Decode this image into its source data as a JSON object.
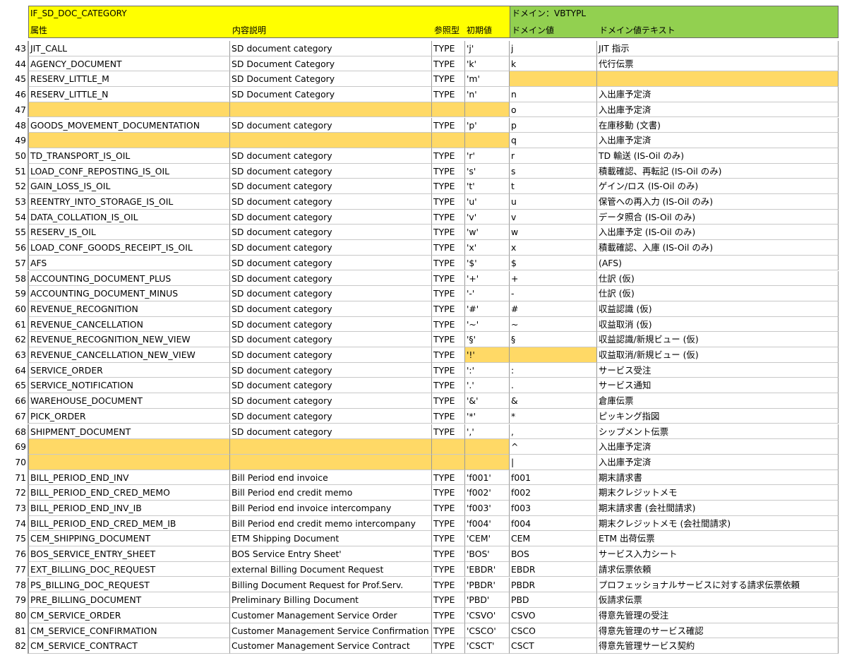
{
  "header": {
    "table_name": "IF_SD_DOC_CATEGORY",
    "col_attribute": "属性",
    "col_description": "内容説明",
    "col_ref_type": "参照型",
    "col_initial_value": "初期値",
    "domain_title": "ドメイン：VBTYPL",
    "col_domain_value": "ドメイン値",
    "col_domain_text": "ドメイン値テキスト"
  },
  "rows": [
    {
      "n": "43",
      "attr": "JIT_CALL",
      "desc": "SD document category",
      "type": "TYPE",
      "init": "'j'",
      "dval": "j",
      "dtext": "JIT 指示",
      "hl": []
    },
    {
      "n": "44",
      "attr": "AGENCY_DOCUMENT",
      "desc": "SD Document Category",
      "type": "TYPE",
      "init": "'k'",
      "dval": "k",
      "dtext": "代行伝票",
      "hl": []
    },
    {
      "n": "45",
      "attr": "RESERV_LITTLE_M",
      "desc": "SD Document Category",
      "type": "TYPE",
      "init": "'m'",
      "dval": "",
      "dtext": "",
      "hl": [
        "dval",
        "dtext"
      ]
    },
    {
      "n": "46",
      "attr": "RESERV_LITTLE_N",
      "desc": "SD Document Category",
      "type": "TYPE",
      "init": "'n'",
      "dval": "n",
      "dtext": "入出庫予定済",
      "hl": []
    },
    {
      "n": "47",
      "attr": "",
      "desc": "",
      "type": "",
      "init": "",
      "dval": "o",
      "dtext": "入出庫予定済",
      "hl": [
        "attr",
        "desc",
        "type",
        "init"
      ]
    },
    {
      "n": "48",
      "attr": "GOODS_MOVEMENT_DOCUMENTATION",
      "desc": "SD document category",
      "type": "TYPE",
      "init": "'p'",
      "dval": "p",
      "dtext": "在庫移動 (文書)",
      "hl": []
    },
    {
      "n": "49",
      "attr": "",
      "desc": "",
      "type": "",
      "init": "",
      "dval": "q",
      "dtext": "入出庫予定済",
      "hl": [
        "attr",
        "desc",
        "type",
        "init"
      ]
    },
    {
      "n": "50",
      "attr": "TD_TRANSPORT_IS_OIL",
      "desc": "SD document category",
      "type": "TYPE",
      "init": "'r'",
      "dval": "r",
      "dtext": "TD 輸送 (IS-Oil のみ)",
      "hl": []
    },
    {
      "n": "51",
      "attr": "LOAD_CONF_REPOSTING_IS_OIL",
      "desc": "SD document category",
      "type": "TYPE",
      "init": "'s'",
      "dval": "s",
      "dtext": "積載確認、再転記 (IS-Oil のみ)",
      "hl": []
    },
    {
      "n": "52",
      "attr": "GAIN_LOSS_IS_OIL",
      "desc": "SD document category",
      "type": "TYPE",
      "init": "'t'",
      "dval": "t",
      "dtext": "ゲイン/ロス (IS-Oil のみ)",
      "hl": []
    },
    {
      "n": "53",
      "attr": "REENTRY_INTO_STORAGE_IS_OIL",
      "desc": "SD document category",
      "type": "TYPE",
      "init": "'u'",
      "dval": "u",
      "dtext": "保管への再入力 (IS-Oil のみ)",
      "hl": []
    },
    {
      "n": "54",
      "attr": "DATA_COLLATION_IS_OIL",
      "desc": "SD document category",
      "type": "TYPE",
      "init": "'v'",
      "dval": "v",
      "dtext": "データ照合 (IS-Oil のみ)",
      "hl": []
    },
    {
      "n": "55",
      "attr": "RESERV_IS_OIL",
      "desc": "SD document category",
      "type": "TYPE",
      "init": "'w'",
      "dval": "w",
      "dtext": "入出庫予定 (IS-Oil のみ)",
      "hl": []
    },
    {
      "n": "56",
      "attr": "LOAD_CONF_GOODS_RECEIPT_IS_OIL",
      "desc": "SD document category",
      "type": "TYPE",
      "init": "'x'",
      "dval": "x",
      "dtext": "積載確認、入庫 (IS-Oil のみ)",
      "hl": []
    },
    {
      "n": "57",
      "attr": "AFS",
      "desc": "SD document category",
      "type": "TYPE",
      "init": "'$'",
      "dval": "$",
      "dtext": "(AFS)",
      "hl": []
    },
    {
      "n": "58",
      "attr": "ACCOUNTING_DOCUMENT_PLUS",
      "desc": "SD document category",
      "type": "TYPE",
      "init": "'+'",
      "dval": "+",
      "dtext": "仕訳 (仮)",
      "hl": []
    },
    {
      "n": "59",
      "attr": "ACCOUNTING_DOCUMENT_MINUS",
      "desc": "SD document category",
      "type": "TYPE",
      "init": "'-'",
      "dval": "-",
      "dtext": "仕訳 (仮)",
      "hl": []
    },
    {
      "n": "60",
      "attr": "REVENUE_RECOGNITION",
      "desc": "SD document category",
      "type": "TYPE",
      "init": "'#'",
      "dval": "#",
      "dtext": "収益認識 (仮)",
      "hl": []
    },
    {
      "n": "61",
      "attr": "REVENUE_CANCELLATION",
      "desc": "SD document category",
      "type": "TYPE",
      "init": "'~'",
      "dval": "~",
      "dtext": "収益取消 (仮)",
      "hl": []
    },
    {
      "n": "62",
      "attr": "REVENUE_RECOGNITION_NEW_VIEW",
      "desc": "SD document category",
      "type": "TYPE",
      "init": "'§'",
      "dval": "§",
      "dtext": "収益認識/新規ビュー (仮)",
      "hl": []
    },
    {
      "n": "63",
      "attr": "REVENUE_CANCELLATION_NEW_VIEW",
      "desc": "SD document category",
      "type": "TYPE",
      "init": "'!'",
      "dval": "",
      "dtext": "収益取消/新規ビュー (仮)",
      "hl": [
        "init",
        "dval"
      ]
    },
    {
      "n": "64",
      "attr": "SERVICE_ORDER",
      "desc": "SD document category",
      "type": "TYPE",
      "init": "':'",
      "dval": ":",
      "dtext": "サービス受注",
      "hl": []
    },
    {
      "n": "65",
      "attr": "SERVICE_NOTIFICATION",
      "desc": "SD document category",
      "type": "TYPE",
      "init": "'.'",
      "dval": ".",
      "dtext": "サービス通知",
      "hl": []
    },
    {
      "n": "66",
      "attr": "WAREHOUSE_DOCUMENT",
      "desc": "SD document category",
      "type": "TYPE",
      "init": "'&'",
      "dval": "&",
      "dtext": "倉庫伝票",
      "hl": []
    },
    {
      "n": "67",
      "attr": "PICK_ORDER",
      "desc": "SD document category",
      "type": "TYPE",
      "init": "'*'",
      "dval": "*",
      "dtext": "ピッキング指図",
      "hl": []
    },
    {
      "n": "68",
      "attr": "SHIPMENT_DOCUMENT",
      "desc": "SD document category",
      "type": "TYPE",
      "init": "','",
      "dval": ",",
      "dtext": "シップメント伝票",
      "hl": []
    },
    {
      "n": "69",
      "attr": "",
      "desc": "",
      "type": "",
      "init": "",
      "dval": "^",
      "dtext": "入出庫予定済",
      "hl": [
        "attr",
        "desc",
        "type",
        "init"
      ]
    },
    {
      "n": "70",
      "attr": "",
      "desc": "",
      "type": "",
      "init": "",
      "dval": "|",
      "dtext": "入出庫予定済",
      "hl": [
        "attr",
        "desc",
        "type",
        "init"
      ]
    },
    {
      "n": "71",
      "attr": "BILL_PERIOD_END_INV",
      "desc": "Bill Period end invoice",
      "type": "TYPE",
      "init": "'f001'",
      "dval": "f001",
      "dtext": "期末請求書",
      "hl": []
    },
    {
      "n": "72",
      "attr": "BILL_PERIOD_END_CRED_MEMO",
      "desc": "Bill Period end credit memo",
      "type": "TYPE",
      "init": "'f002'",
      "dval": "f002",
      "dtext": "期末クレジットメモ",
      "hl": []
    },
    {
      "n": "73",
      "attr": "BILL_PERIOD_END_INV_IB",
      "desc": "Bill Period end invoice intercompany",
      "type": "TYPE",
      "init": "'f003'",
      "dval": "f003",
      "dtext": "期末請求書 (会社間請求)",
      "hl": []
    },
    {
      "n": "74",
      "attr": "BILL_PERIOD_END_CRED_MEM_IB",
      "desc": "Bill Period end credit memo intercompany",
      "type": "TYPE",
      "init": "'f004'",
      "dval": "f004",
      "dtext": "期末クレジットメモ (会社間請求)",
      "hl": []
    },
    {
      "n": "75",
      "attr": "CEM_SHIPPING_DOCUMENT",
      "desc": "ETM Shipping Document",
      "type": "TYPE",
      "init": "'CEM'",
      "dval": "CEM",
      "dtext": "ETM 出荷伝票",
      "hl": []
    },
    {
      "n": "76",
      "attr": "BOS_SERVICE_ENTRY_SHEET",
      "desc": "BOS Service Entry Sheet'",
      "type": "TYPE",
      "init": "'BOS'",
      "dval": "BOS",
      "dtext": "サービス入力シート",
      "hl": []
    },
    {
      "n": "77",
      "attr": "EXT_BILLING_DOC_REQUEST",
      "desc": "external Billing Document Request",
      "type": "TYPE",
      "init": "'EBDR'",
      "dval": "EBDR",
      "dtext": "請求伝票依頼",
      "hl": []
    },
    {
      "n": "78",
      "attr": "PS_BILLING_DOC_REQUEST",
      "desc": "Billing Document Request for Prof.Serv.",
      "type": "TYPE",
      "init": "'PBDR'",
      "dval": "PBDR",
      "dtext": "プロフェッショナルサービスに対する請求伝票依頼",
      "hl": []
    },
    {
      "n": "79",
      "attr": "PRE_BILLING_DOCUMENT",
      "desc": "Preliminary Billing Document",
      "type": "TYPE",
      "init": "'PBD'",
      "dval": "PBD",
      "dtext": "仮請求伝票",
      "hl": []
    },
    {
      "n": "80",
      "attr": "CM_SERVICE_ORDER",
      "desc": "Customer Management Service Order",
      "type": "TYPE",
      "init": "'CSVO'",
      "dval": "CSVO",
      "dtext": "得意先管理の受注",
      "hl": []
    },
    {
      "n": "81",
      "attr": "CM_SERVICE_CONFIRMATION",
      "desc": "Customer Management Service Confirmation",
      "type": "TYPE",
      "init": "'CSCO'",
      "dval": "CSCO",
      "dtext": "得意先管理のサービス確認",
      "hl": []
    },
    {
      "n": "82",
      "attr": "CM_SERVICE_CONTRACT",
      "desc": "Customer Management Service Contract",
      "type": "TYPE",
      "init": "'CSCT'",
      "dval": "CSCT",
      "dtext": "得意先管理サービス契約",
      "hl": []
    }
  ]
}
